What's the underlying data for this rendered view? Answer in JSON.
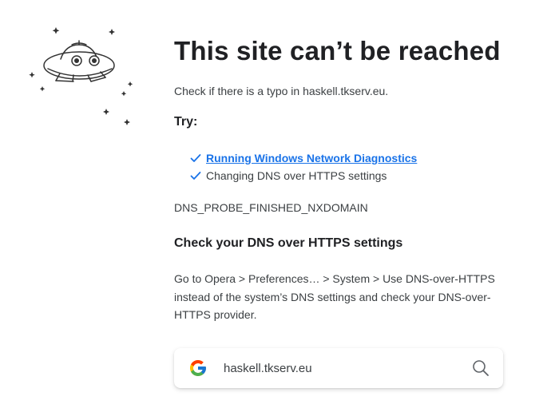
{
  "error_page": {
    "title": "This site can’t be reached",
    "subtitle": "Check if there is a typo in haskell.tkserv.eu.",
    "try_label": "Try:",
    "suggestions": [
      {
        "label": "Running Windows Network Diagnostics",
        "is_link": true
      },
      {
        "label": "Changing DNS over HTTPS settings",
        "is_link": false
      }
    ],
    "error_code": "DNS_PROBE_FINISHED_NXDOMAIN",
    "dns_heading": "Check your DNS over HTTPS settings",
    "dns_text": "Go to Opera > Preferences… > System > Use DNS-over-HTTPS instead of the system’s DNS settings and check your DNS-over-HTTPS provider."
  },
  "search": {
    "value": "haskell.tkserv.eu",
    "logo_icon": "google-g-icon",
    "search_icon": "magnifier-icon"
  },
  "illustration": {
    "icon": "ufo-illustration"
  },
  "colors": {
    "link": "#1a73e8",
    "check": "#1a73e8",
    "text": "#3c4043",
    "heading": "#202124"
  }
}
